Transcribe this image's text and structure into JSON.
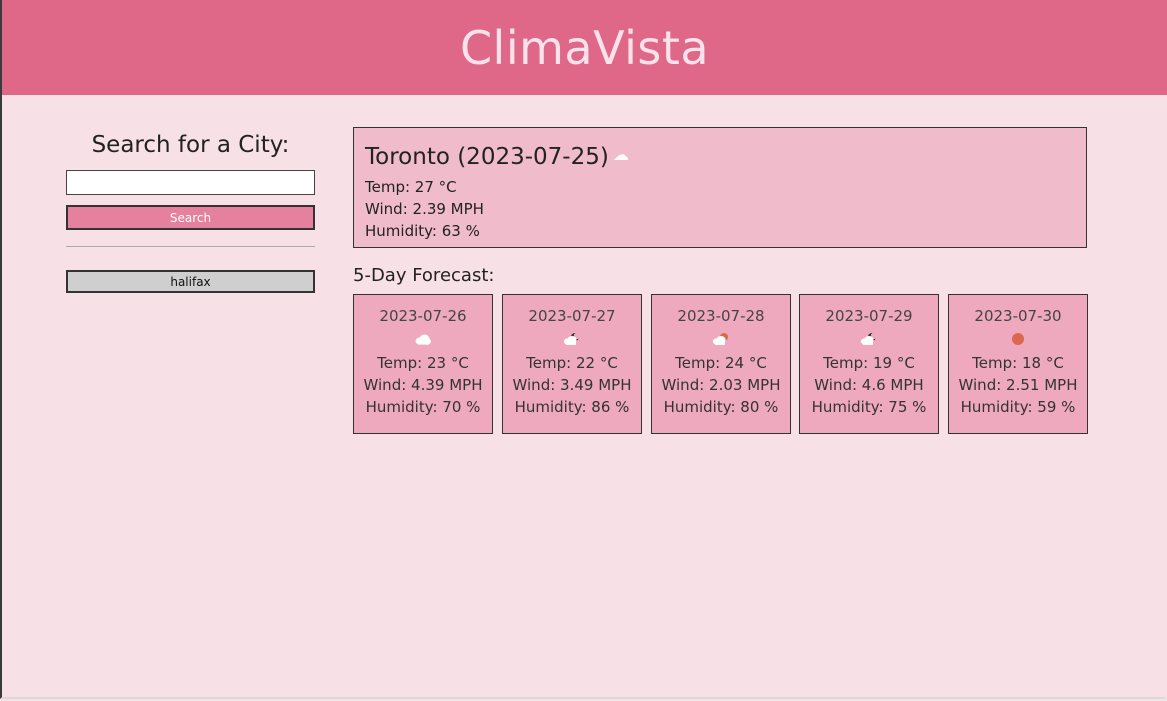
{
  "header": {
    "title": "ClimaVista"
  },
  "search": {
    "heading": "Search for a City:",
    "input_value": "",
    "placeholder": "",
    "button_label": "Search"
  },
  "history": [
    "halifax"
  ],
  "current": {
    "title": "Toronto (2023-07-25)",
    "icon": "cloud-icon",
    "temp": "Temp: 27 °C",
    "wind": "Wind: 2.39 MPH",
    "humidity": "Humidity: 63 %"
  },
  "forecast": {
    "title": "5-Day Forecast:",
    "days": [
      {
        "date": "2023-07-26",
        "icon": "cloud-icon",
        "temp": "Temp: 23 °C",
        "wind": "Wind: 4.39 MPH",
        "humidity": "Humidity: 70 %"
      },
      {
        "date": "2023-07-27",
        "icon": "night-cloud-icon",
        "temp": "Temp: 22 °C",
        "wind": "Wind: 3.49 MPH",
        "humidity": "Humidity: 86 %"
      },
      {
        "date": "2023-07-28",
        "icon": "sun-cloud-icon",
        "temp": "Temp: 24 °C",
        "wind": "Wind: 2.03 MPH",
        "humidity": "Humidity: 80 %"
      },
      {
        "date": "2023-07-29",
        "icon": "night-cloud-icon",
        "temp": "Temp: 19 °C",
        "wind": "Wind: 4.6 MPH",
        "humidity": "Humidity: 75 %"
      },
      {
        "date": "2023-07-30",
        "icon": "sun-icon",
        "temp": "Temp: 18 °C",
        "wind": "Wind: 2.51 MPH",
        "humidity": "Humidity: 59 %"
      }
    ]
  },
  "colors": {
    "header": "#df6788",
    "background": "#f7e1e7",
    "current_card": "#f0bccb",
    "forecast_card": "#efa9bf",
    "search_button": "#e6809f",
    "history_button": "#cfcfcf"
  }
}
